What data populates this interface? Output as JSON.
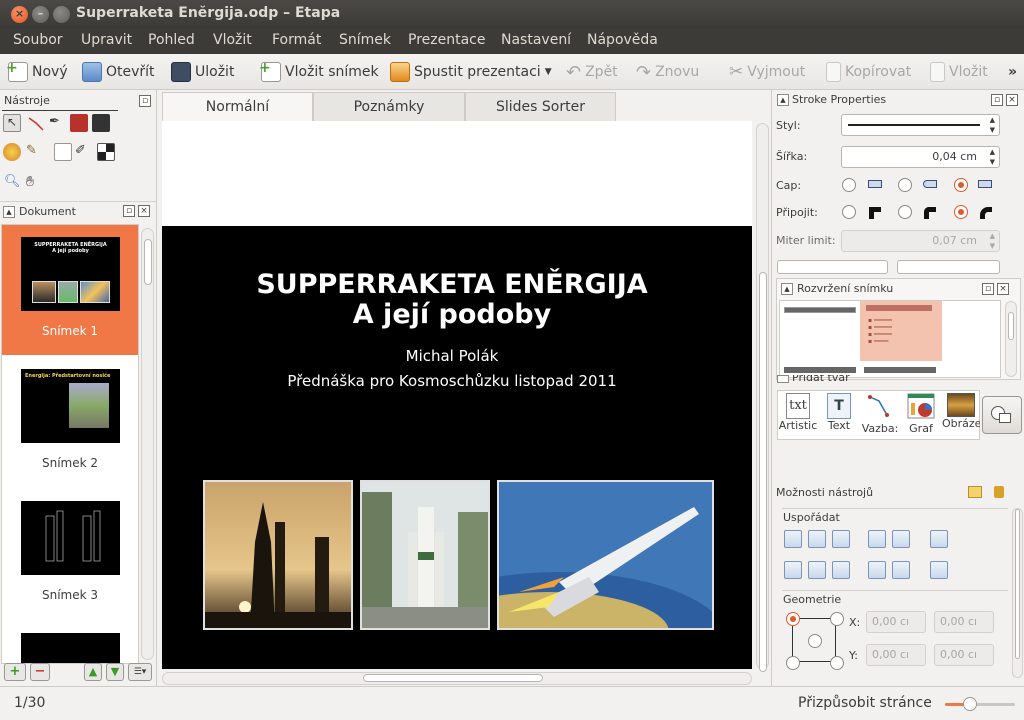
{
  "window": {
    "title": "Superraketa Enĕrgija.odp – Etapa"
  },
  "menu": [
    "Soubor",
    "Upravit",
    "Pohled",
    "Vložit",
    "Formát",
    "Snímek",
    "Prezentace",
    "Nastavení",
    "Nápověda"
  ],
  "toolbar": {
    "new": "Nový",
    "open": "Otevřít",
    "save": "Uložit",
    "insert_slide": "Vložit snímek",
    "start_presentation": "Spustit prezentaci",
    "undo": "Zpět",
    "redo": "Znovu",
    "cut": "Vyjmout",
    "copy": "Kopírovat",
    "paste": "Vložit",
    "overflow": "»"
  },
  "left_panel": {
    "tools_title": "Nástroje",
    "document_title": "Dokument",
    "slides": [
      {
        "label": "Snímek 1",
        "thumb_title": "SUPPERRAKETA ENĚRGIJA",
        "thumb_sub": "A její podoby"
      },
      {
        "label": "Snímek 2",
        "thumb_title": "Energija: Předstartovní nosiče"
      },
      {
        "label": "Snímek 3"
      }
    ]
  },
  "tabs": [
    "Normální",
    "Poznámky",
    "Slides Sorter"
  ],
  "slide": {
    "title_line1": "SUPPERRAKETA ENĚRGIJA",
    "title_line2": "A její podoby",
    "author": "Michal Polák",
    "subtitle": "Přednáška pro Kosmoschůzku listopad 2011"
  },
  "right_panel": {
    "stroke_title": "Stroke Properties",
    "style_label": "Styl:",
    "width_label": "Šířka:",
    "width_value": "0,04 cm",
    "cap_label": "Cap:",
    "join_label": "Připojit:",
    "miter_label": "Miter limit:",
    "miter_value": "0,07 cm",
    "layout_title": "Rozvržení snímku",
    "shapes_title": "Přidat tvar",
    "shapes": [
      "Artistic",
      "Text",
      "Vazba:",
      "Graf",
      "Obráze"
    ],
    "tool_options_title": "Možnosti nástrojů",
    "arrange_label": "Uspořádat",
    "geometry_label": "Geometrie",
    "x_label": "X:",
    "y_label": "Y:",
    "geo_value": "0,00 cı"
  },
  "status": {
    "page": "1/30",
    "zoom_label": "Přizpůsobit stránce",
    "zoom_level": 0.35
  },
  "colors": {
    "accent": "#f07746",
    "titlebar": "#3c3b37",
    "slide_bg": "#000000"
  }
}
